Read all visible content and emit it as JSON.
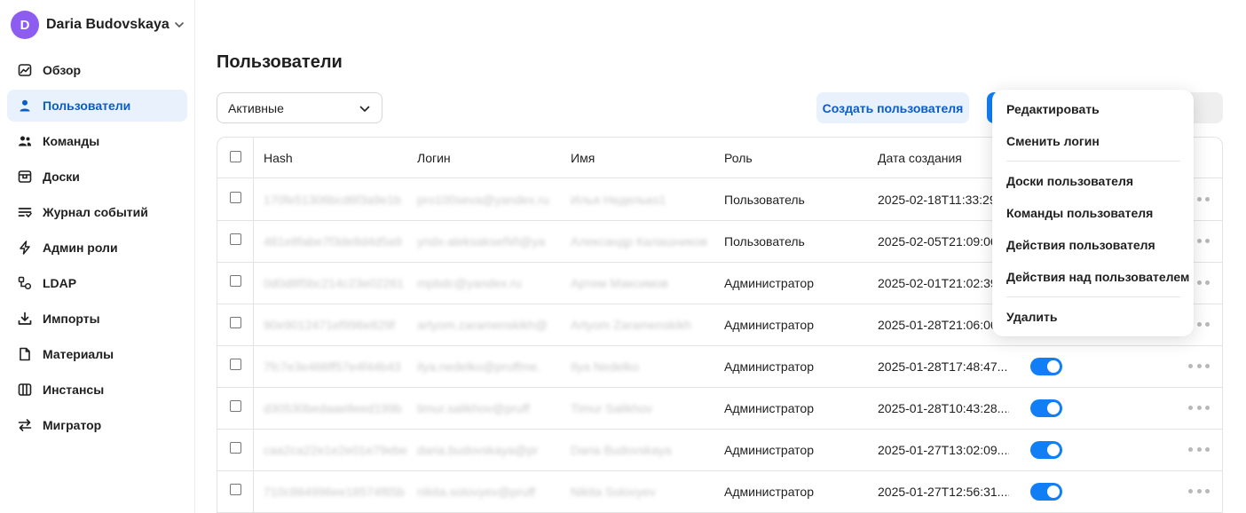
{
  "user": {
    "initial": "D",
    "name": "Daria Budovskaya",
    "avatar_color": "#8d5cf0"
  },
  "sidebar": {
    "items": [
      {
        "label": "Обзор",
        "icon": "chart-icon",
        "active": false
      },
      {
        "label": "Пользователи",
        "icon": "person-icon",
        "active": true
      },
      {
        "label": "Команды",
        "icon": "people-icon",
        "active": false
      },
      {
        "label": "Доски",
        "icon": "board-icon",
        "active": false
      },
      {
        "label": "Журнал событий",
        "icon": "list-icon",
        "active": false
      },
      {
        "label": "Админ роли",
        "icon": "bolt-icon",
        "active": false
      },
      {
        "label": "LDAP",
        "icon": "ldap-icon",
        "active": false
      },
      {
        "label": "Импорты",
        "icon": "import-icon",
        "active": false
      },
      {
        "label": "Материалы",
        "icon": "file-icon",
        "active": false
      },
      {
        "label": "Инстансы",
        "icon": "columns-icon",
        "active": false
      },
      {
        "label": "Мигратор",
        "icon": "arrows-icon",
        "active": false
      }
    ]
  },
  "main": {
    "title": "Пользователи",
    "filter_value": "Активные",
    "create_button": "Создать пользователя",
    "accent_color": "#117ef5"
  },
  "table": {
    "columns": [
      "Hash",
      "Логин",
      "Имя",
      "Роль",
      "Дата создания"
    ],
    "rows": [
      {
        "hash": "170fe51306bcd6f3a9e1b",
        "login": "pro100seva@yandex.ru",
        "name": "Илья Неделько1",
        "role": "Пользователь",
        "created": "2025-02-18T11:33:29"
      },
      {
        "hash": "481e8fabe7f3de8d4d5a9",
        "login": "yndx-aleksakseñiñ@ya",
        "name": "Александр Калашников",
        "role": "Пользователь",
        "created": "2025-02-05T21:09:06"
      },
      {
        "hash": "0d0d8f5bc214c23e02261",
        "login": "mpbdc@yandex.ru",
        "name": "Артем Максимов",
        "role": "Администратор",
        "created": "2025-02-01T21:02:39"
      },
      {
        "hash": "90e9012471ef996e829f",
        "login": "artyom.zaramenskikh@",
        "name": "Artyom Zaramenskikh",
        "role": "Администратор",
        "created": "2025-01-28T21:06:06"
      },
      {
        "hash": "7fc7e3e466ff57e4f44b43",
        "login": "ilya.nedelko@pruffme.",
        "name": "Ilya Nedelko",
        "role": "Администратор",
        "created": "2025-01-28T17:48:47...",
        "toggle": true
      },
      {
        "hash": "d30530bedaae8eed199b",
        "login": "timur.salikhov@pruff",
        "name": "Timur Salikhov",
        "role": "Администратор",
        "created": "2025-01-28T10:43:28....",
        "toggle": true
      },
      {
        "hash": "caa2ca22e1e2e01e79ebe",
        "login": "daria.budovskaya@pr",
        "name": "Daria Budovskaya",
        "role": "Администратор",
        "created": "2025-01-27T13:02:09....",
        "toggle": true
      },
      {
        "hash": "710c864996ee18574f65b",
        "login": "nikita.solovyev@pruff",
        "name": "Nikita Solovyev",
        "role": "Администратор",
        "created": "2025-01-27T12:56:31....",
        "toggle": true
      }
    ]
  },
  "menu": {
    "group1": [
      "Редактировать",
      "Сменить логин"
    ],
    "group2": [
      "Доски пользователя",
      "Команды пользователя",
      "Действия пользователя",
      "Действия над пользователем"
    ],
    "group3": [
      "Удалить"
    ]
  }
}
